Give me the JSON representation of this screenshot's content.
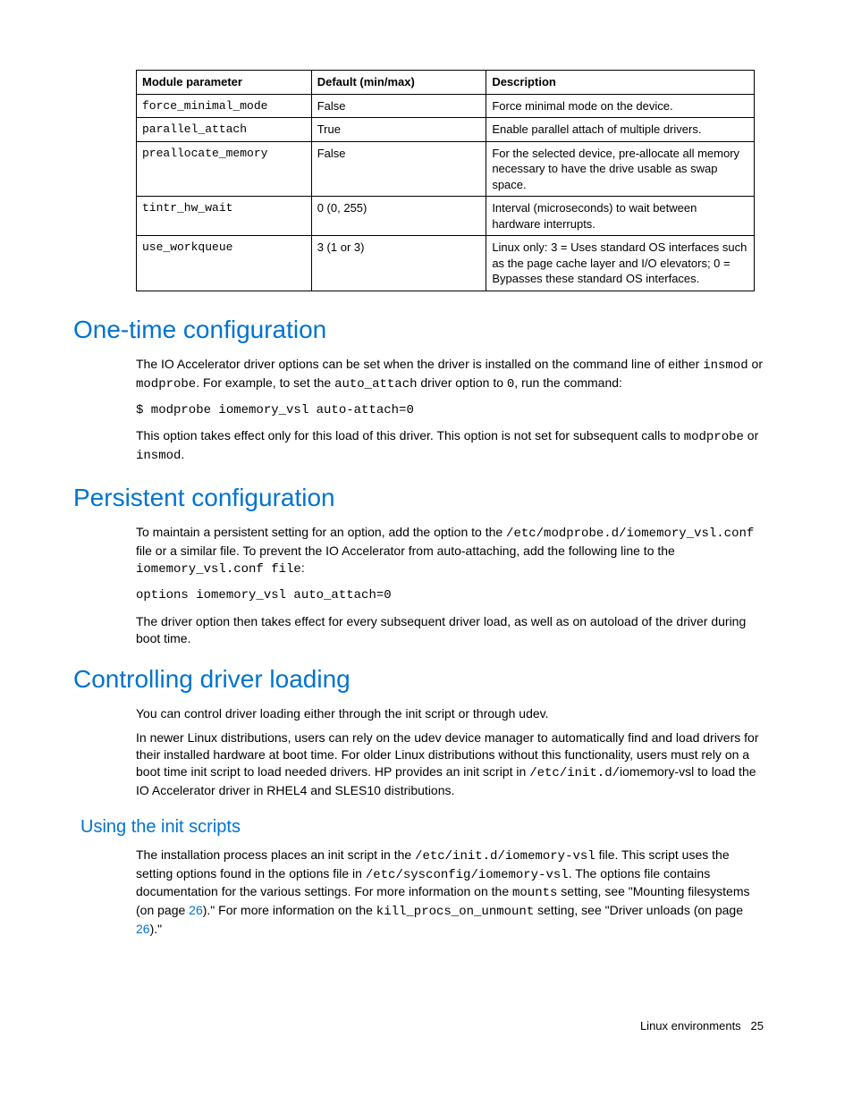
{
  "table": {
    "headers": [
      "Module parameter",
      "Default (min/max)",
      "Description"
    ],
    "rows": [
      {
        "param": "force_minimal_mode",
        "default": "False",
        "desc": "Force minimal mode on the device."
      },
      {
        "param": "parallel_attach",
        "default": "True",
        "desc": "Enable parallel attach of multiple drivers."
      },
      {
        "param": "preallocate_memory",
        "default": "False",
        "desc": "For the selected device, pre-allocate all memory necessary to have the drive usable as swap space."
      },
      {
        "param": "tintr_hw_wait",
        "default": "0 (0, 255)",
        "desc": "Interval (microseconds) to wait between hardware interrupts."
      },
      {
        "param": "use_workqueue",
        "default": "3 (1 or 3)",
        "desc": "Linux only: 3 = Uses standard OS interfaces such as the page cache layer and I/O elevators; 0 = Bypasses these standard OS interfaces."
      }
    ]
  },
  "sections": {
    "onetime": {
      "title": "One-time configuration",
      "p1a": "The IO Accelerator driver options can be set when the driver is installed on the command line of either ",
      "p1b": "insmod",
      "p1c": " or ",
      "p1d": "modprobe",
      "p1e": ". For example, to set the ",
      "p1f": "auto_attach",
      "p1g": " driver option to ",
      "p1h": "0",
      "p1i": ", run the command:",
      "cmd": "$ modprobe iomemory_vsl auto-attach=0",
      "p2a": "This option takes effect only for this load of this driver. This option is not set for subsequent calls to ",
      "p2b": "modprobe",
      "p2c": " or ",
      "p2d": "insmod",
      "p2e": "."
    },
    "persistent": {
      "title": "Persistent configuration",
      "p1a": "To maintain a persistent setting for an option, add the option to the ",
      "p1b": "/etc/modprobe.d/iomemory_vsl.conf",
      "p1c": " file or a similar file. To prevent the IO Accelerator from auto-attaching, add the following line to the ",
      "p1d": "iomemory_vsl.conf file",
      "p1e": ":",
      "cmd": "options iomemory_vsl auto_attach=0",
      "p2": "The driver option then takes effect for every subsequent driver load, as well as on autoload of the driver during boot time."
    },
    "controlling": {
      "title": "Controlling driver loading",
      "p1": "You can control driver loading either through the init script or through udev.",
      "p2a": "In newer Linux distributions, users can rely on the udev device manager to automatically find and load drivers for their installed hardware at boot time. For older Linux distributions without this functionality, users must rely on a boot time init script to load needed drivers. HP provides an init script in ",
      "p2b": "/etc/init.d/",
      "p2c": "iomemory-vsl  to load the IO Accelerator driver in RHEL4 and SLES10 distributions."
    },
    "initscripts": {
      "title": "Using the init scripts",
      "p1a": "The installation process places an init script in the ",
      "p1b": "/etc/init.d/iomemory-vsl",
      "p1c": " file. This script uses the setting options found in the options file in ",
      "p1d": "/etc/sysconfig/iomemory-vsl",
      "p1e": ". The options file contains documentation for the various settings. For more information on the ",
      "p1f": "mounts",
      "p1g": " setting, see \"Mounting filesystems (on page ",
      "p1h": "26",
      "p1i": ").\" For more information on the ",
      "p1j": "kill_procs_on_unmount",
      "p1k": " setting, see \"Driver unloads (on page ",
      "p1l": "26",
      "p1m": ").\""
    }
  },
  "footer": {
    "label": "Linux environments",
    "page": "25"
  }
}
